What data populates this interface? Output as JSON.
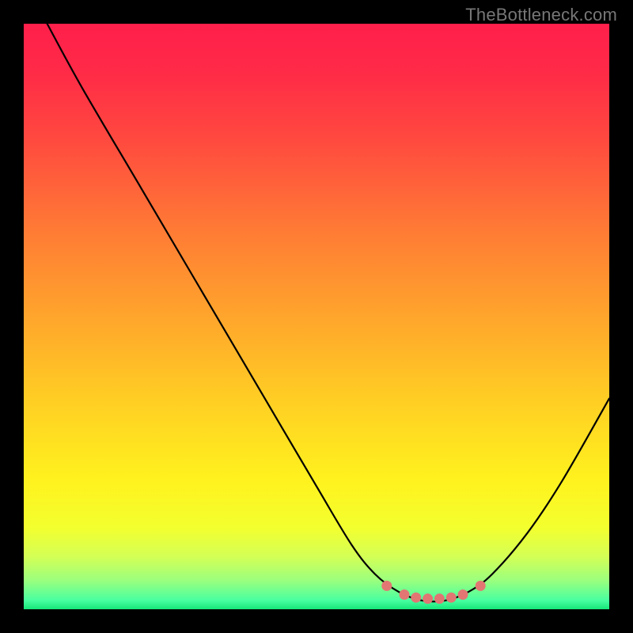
{
  "watermark": "TheBottleneck.com",
  "chart_data": {
    "type": "line",
    "title": "",
    "xlabel": "",
    "ylabel": "",
    "xlim": [
      0,
      100
    ],
    "ylim": [
      0,
      100
    ],
    "grid": false,
    "series": [
      {
        "name": "bottleneck-curve",
        "x": [
          4,
          10,
          20,
          30,
          40,
          50,
          56,
          60,
          64,
          68,
          72,
          76,
          80,
          86,
          92,
          100
        ],
        "values": [
          100,
          89,
          72,
          55,
          38,
          21,
          11,
          6,
          3,
          1.5,
          1.5,
          3,
          6,
          13,
          22,
          36
        ]
      }
    ],
    "markers": [
      {
        "x": 62,
        "y": 4.0
      },
      {
        "x": 65,
        "y": 2.5
      },
      {
        "x": 67,
        "y": 2.0
      },
      {
        "x": 69,
        "y": 1.8
      },
      {
        "x": 71,
        "y": 1.8
      },
      {
        "x": 73,
        "y": 2.0
      },
      {
        "x": 75,
        "y": 2.5
      },
      {
        "x": 78,
        "y": 4.0
      }
    ],
    "gradient_stops": [
      {
        "offset": 0.0,
        "color": "#ff1f4b"
      },
      {
        "offset": 0.08,
        "color": "#ff2a47"
      },
      {
        "offset": 0.2,
        "color": "#ff4a3f"
      },
      {
        "offset": 0.35,
        "color": "#ff7a35"
      },
      {
        "offset": 0.5,
        "color": "#ffa52c"
      },
      {
        "offset": 0.65,
        "color": "#ffd023"
      },
      {
        "offset": 0.78,
        "color": "#fff21e"
      },
      {
        "offset": 0.86,
        "color": "#f3ff2e"
      },
      {
        "offset": 0.91,
        "color": "#d4ff55"
      },
      {
        "offset": 0.95,
        "color": "#9cff7d"
      },
      {
        "offset": 0.985,
        "color": "#48ffa0"
      },
      {
        "offset": 1.0,
        "color": "#16e779"
      }
    ]
  }
}
